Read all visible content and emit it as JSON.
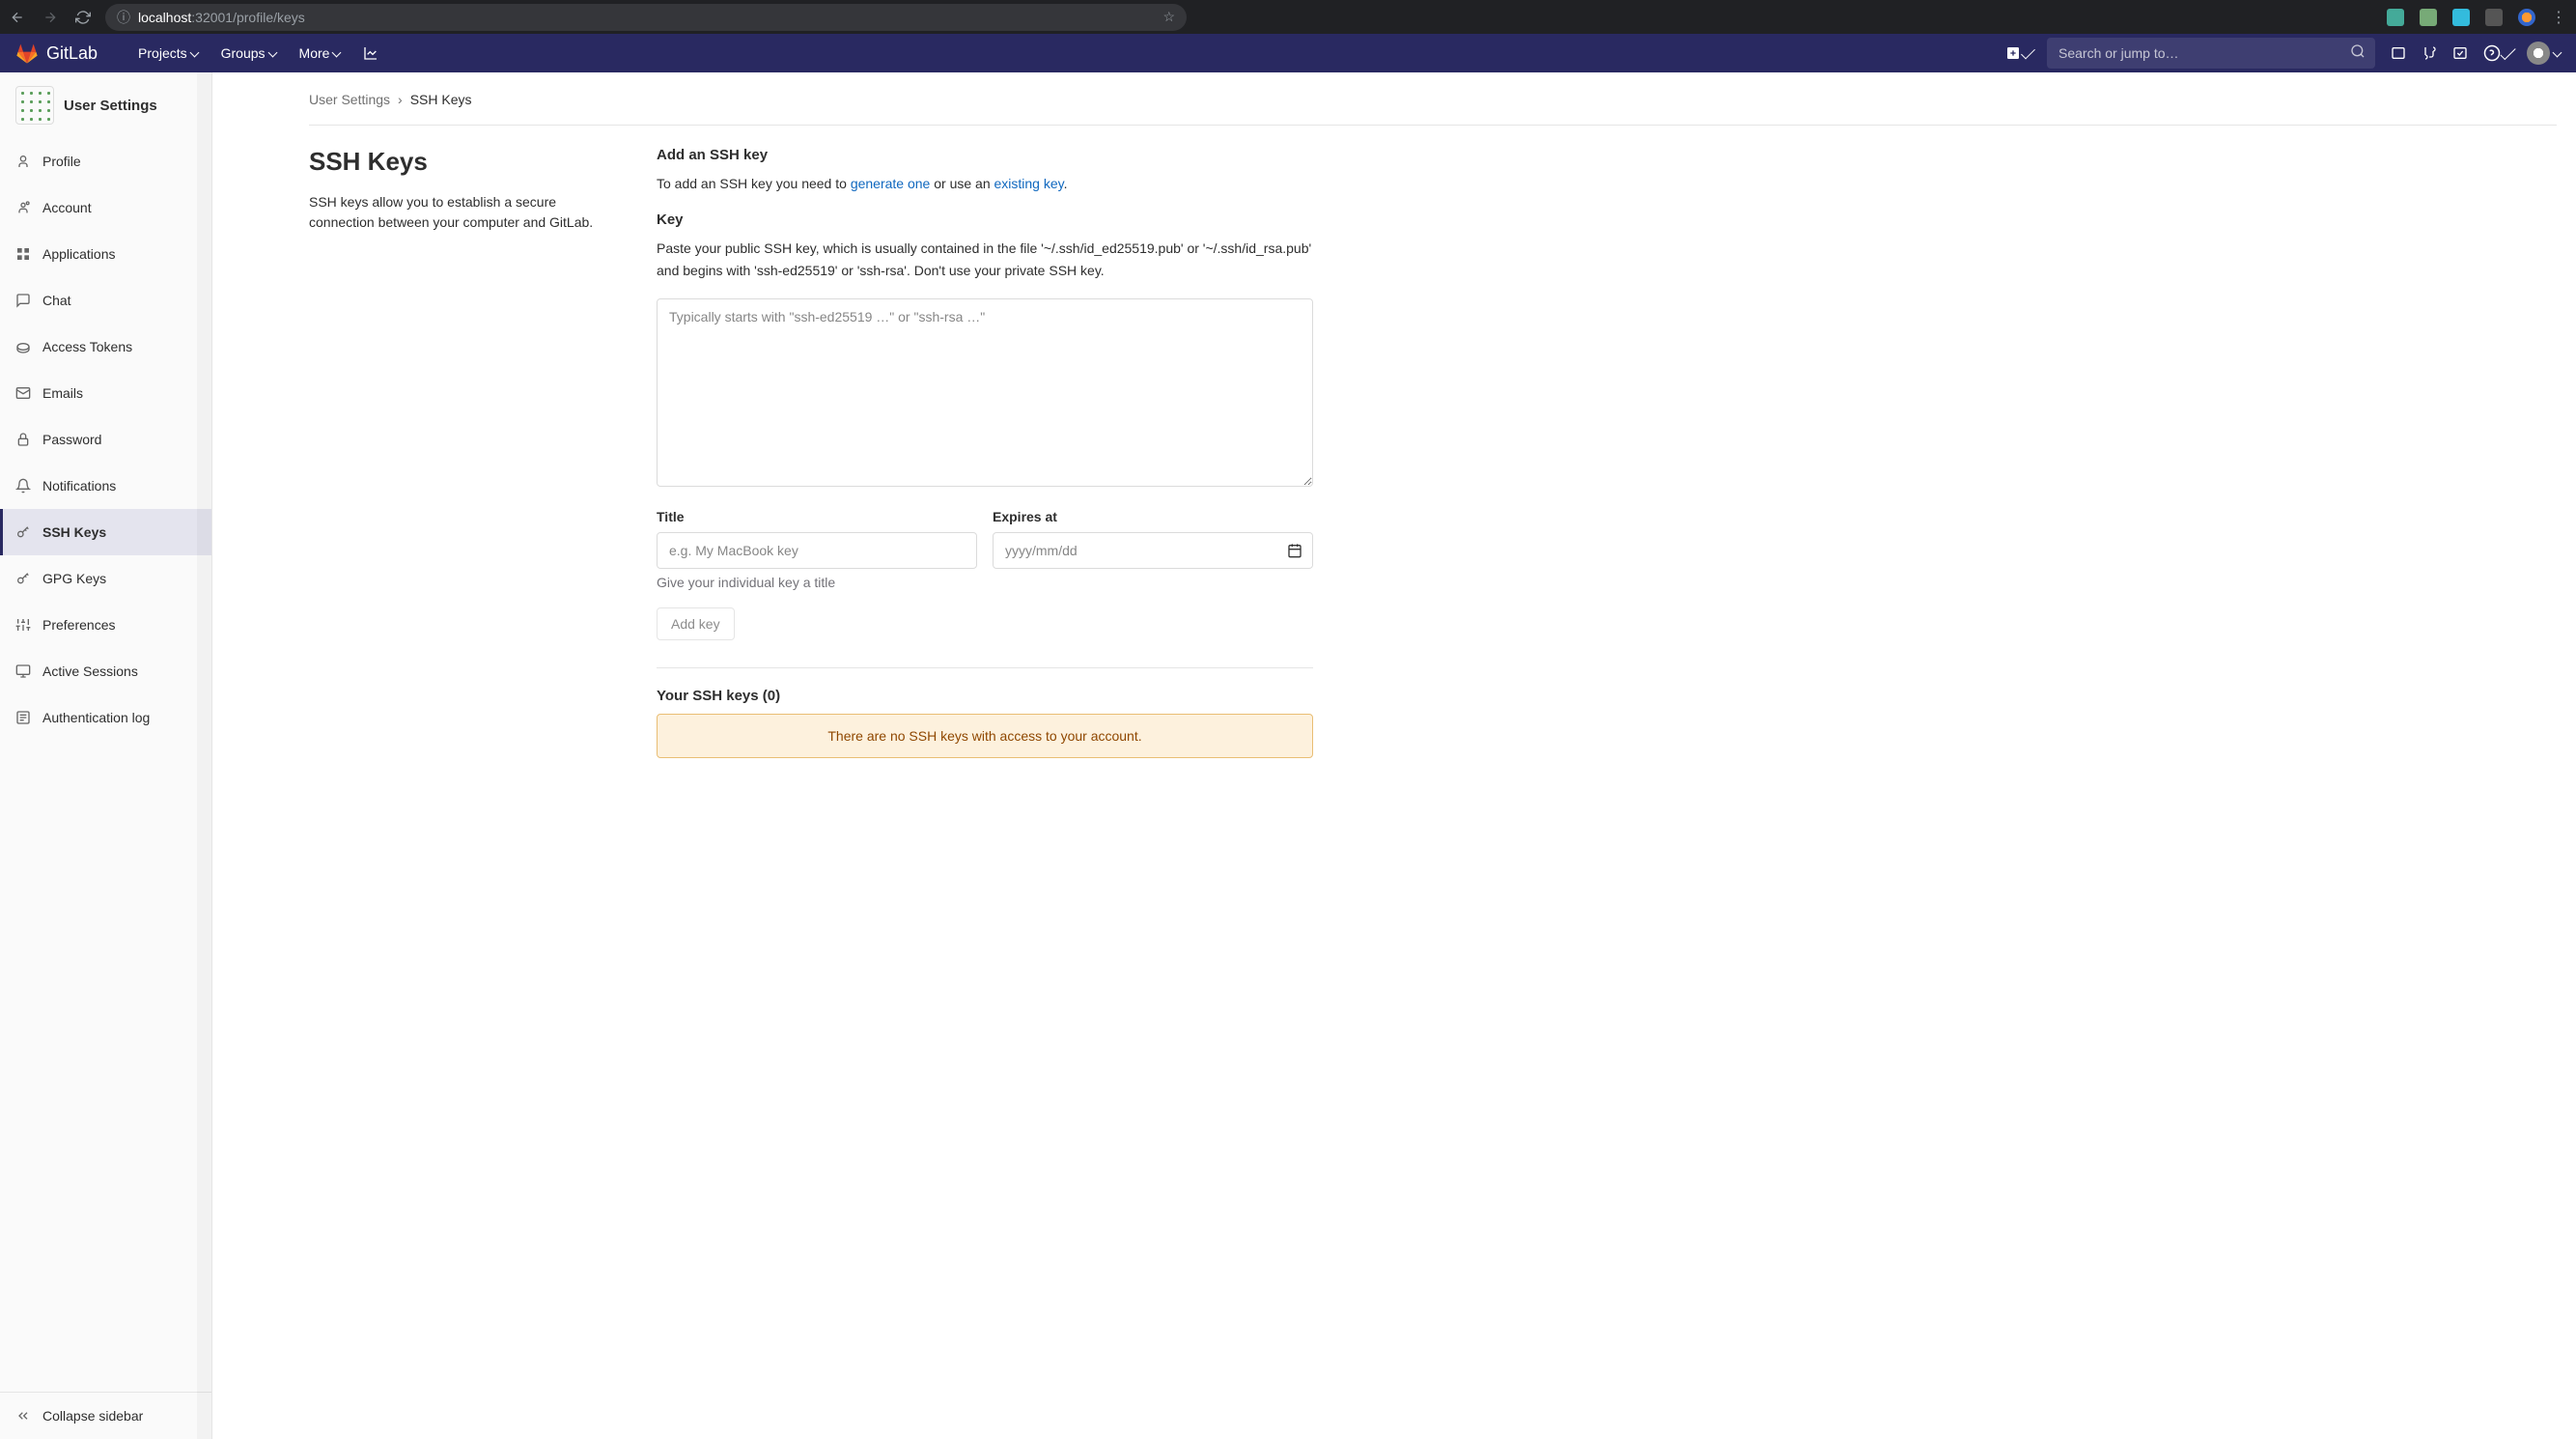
{
  "browser": {
    "url_info_icon": "ⓘ",
    "url_host": "localhost",
    "url_port_path": ":32001/profile/keys"
  },
  "topnav": {
    "brand": "GitLab",
    "links": [
      {
        "label": "Projects"
      },
      {
        "label": "Groups"
      },
      {
        "label": "More"
      }
    ],
    "search_placeholder": "Search or jump to…"
  },
  "sidebar": {
    "title": "User Settings",
    "items": [
      {
        "label": "Profile",
        "icon": "profile"
      },
      {
        "label": "Account",
        "icon": "account"
      },
      {
        "label": "Applications",
        "icon": "apps"
      },
      {
        "label": "Chat",
        "icon": "chat"
      },
      {
        "label": "Access Tokens",
        "icon": "tokens"
      },
      {
        "label": "Emails",
        "icon": "emails"
      },
      {
        "label": "Password",
        "icon": "password"
      },
      {
        "label": "Notifications",
        "icon": "notifications"
      },
      {
        "label": "SSH Keys",
        "icon": "sshkeys"
      },
      {
        "label": "GPG Keys",
        "icon": "gpgkeys"
      },
      {
        "label": "Preferences",
        "icon": "preferences"
      },
      {
        "label": "Active Sessions",
        "icon": "sessions"
      },
      {
        "label": "Authentication log",
        "icon": "authlog"
      }
    ],
    "collapse": "Collapse sidebar"
  },
  "breadcrumb": {
    "root": "User Settings",
    "current": "SSH Keys"
  },
  "page": {
    "title": "SSH Keys",
    "desc": "SSH keys allow you to establish a secure connection between your computer and GitLab.",
    "add_heading": "Add an SSH key",
    "add_text_pre": "To add an SSH key you need to ",
    "link_generate": "generate one",
    "add_text_mid": " or use an ",
    "link_existing": "existing key",
    "add_text_post": ".",
    "key_label": "Key",
    "key_help": "Paste your public SSH key, which is usually contained in the file '~/.ssh/id_ed25519.pub' or '~/.ssh/id_rsa.pub' and begins with 'ssh-ed25519' or 'ssh-rsa'. Don't use your private SSH key.",
    "key_placeholder": "Typically starts with \"ssh-ed25519 …\" or \"ssh-rsa …\"",
    "title_label": "Title",
    "title_placeholder": "e.g. My MacBook key",
    "title_help": "Give your individual key a title",
    "expires_label": "Expires at",
    "expires_placeholder": "yyyy/mm/dd",
    "btn_add": "Add key",
    "list_heading": "Your SSH keys (0)",
    "empty_warning": "There are no SSH keys with access to your account."
  }
}
